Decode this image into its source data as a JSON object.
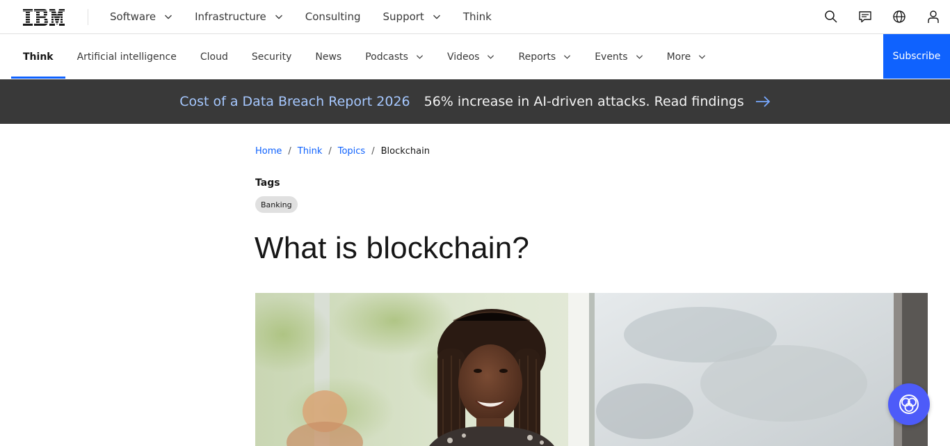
{
  "brand": {
    "logo_text": "IBM",
    "icon": "ibm-logo-icon"
  },
  "top_nav": {
    "items": [
      {
        "label": "Software",
        "has_dropdown": true
      },
      {
        "label": "Infrastructure",
        "has_dropdown": true
      },
      {
        "label": "Consulting",
        "has_dropdown": false
      },
      {
        "label": "Support",
        "has_dropdown": true
      },
      {
        "label": "Think",
        "has_dropdown": false
      }
    ],
    "tools": [
      "search-icon",
      "chat-icon",
      "globe-icon",
      "user-icon"
    ]
  },
  "sub_nav": {
    "items": [
      {
        "label": "Think",
        "active": true,
        "has_dropdown": false
      },
      {
        "label": "Artificial intelligence",
        "active": false,
        "has_dropdown": false
      },
      {
        "label": "Cloud",
        "active": false,
        "has_dropdown": false
      },
      {
        "label": "Security",
        "active": false,
        "has_dropdown": false
      },
      {
        "label": "News",
        "active": false,
        "has_dropdown": false
      },
      {
        "label": "Podcasts",
        "active": false,
        "has_dropdown": true
      },
      {
        "label": "Videos",
        "active": false,
        "has_dropdown": true
      },
      {
        "label": "Reports",
        "active": false,
        "has_dropdown": true
      },
      {
        "label": "Events",
        "active": false,
        "has_dropdown": true
      },
      {
        "label": "More",
        "active": false,
        "has_dropdown": true
      }
    ],
    "subscribe_label": "Subscribe"
  },
  "banner": {
    "title": "Cost of a Data Breach Report 2026",
    "text": "56% increase in AI-driven attacks. Read findings",
    "icon": "arrow-right-icon"
  },
  "breadcrumb": {
    "links": [
      "Home",
      "Think",
      "Topics"
    ],
    "current": "Blockchain",
    "separator": "/"
  },
  "tags": {
    "label": "Tags",
    "items": [
      "Banking"
    ]
  },
  "article": {
    "title": "What is blockchain?"
  },
  "hero_image": {
    "description_icon": "hero-photo"
  },
  "ai_assistant": {
    "icon": "ai-assistant-icon"
  },
  "colors": {
    "accent": "#0f62fe",
    "banner_bg": "#393939",
    "banner_title": "#a6c8ff",
    "fab": "#4d5bf9"
  }
}
